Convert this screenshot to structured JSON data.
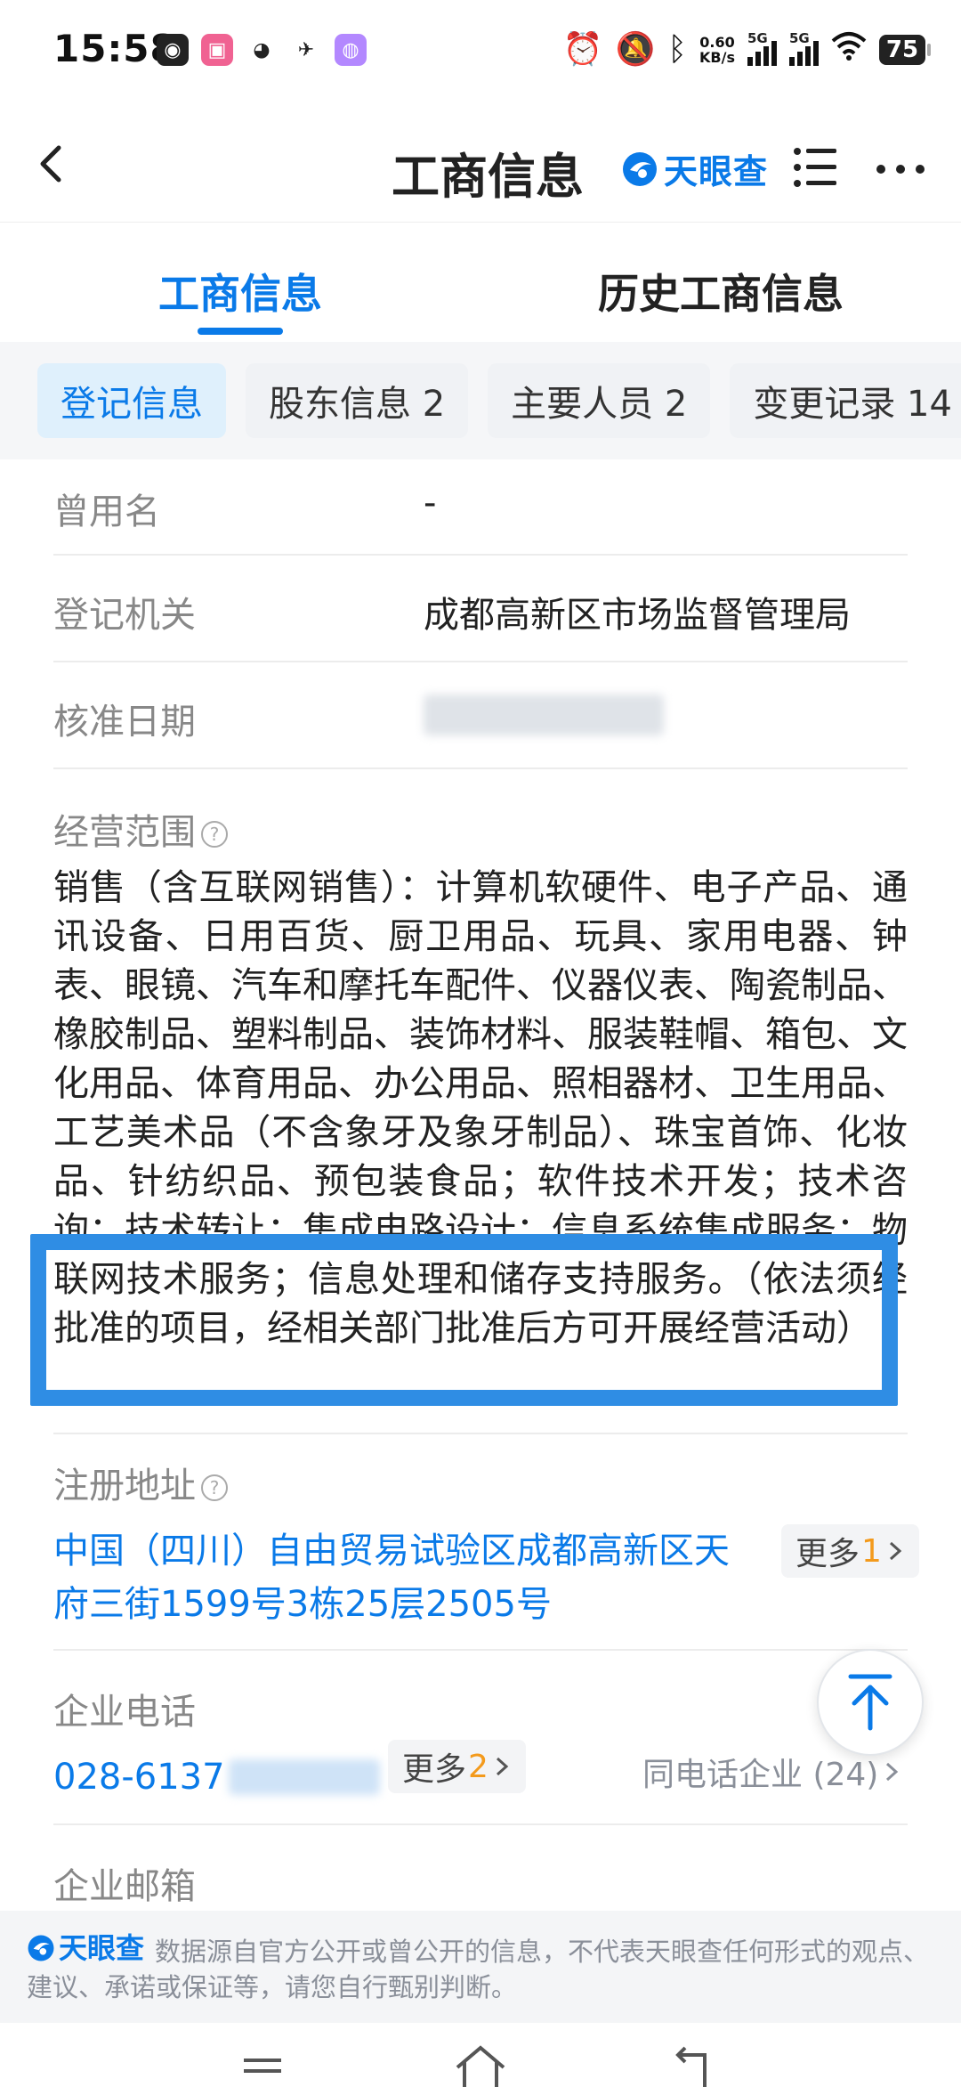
{
  "status_bar": {
    "time": "15:58",
    "network_speed_value": "0.60",
    "network_speed_unit": "KB/s",
    "signal_1_tag": "5G",
    "signal_2_tag": "5G",
    "battery": "75"
  },
  "header": {
    "title": "工商信息",
    "brand": "天眼查"
  },
  "main_tabs": [
    {
      "label": "工商信息",
      "active": true
    },
    {
      "label": "历史工商信息",
      "active": false
    }
  ],
  "sub_tabs": [
    {
      "label": "登记信息",
      "active": true
    },
    {
      "label": "股东信息 2",
      "active": false
    },
    {
      "label": "主要人员 2",
      "active": false
    },
    {
      "label": "变更记录 14",
      "active": false
    }
  ],
  "fields": {
    "former_name": {
      "label": "曾用名",
      "value": "-"
    },
    "registration_authority": {
      "label": "登记机关",
      "value": "成都高新区市场监督管理局"
    },
    "approval_date": {
      "label": "核准日期"
    },
    "business_scope": {
      "label": "经营范围",
      "value": "销售（含互联网销售）：计算机软硬件、电子产品、通讯设备、日用百货、厨卫用品、玩具、家用电器、钟表、眼镜、汽车和摩托车配件、仪器仪表、陶瓷制品、橡胶制品、塑料制品、装饰材料、服装鞋帽、箱包、文化用品、体育用品、办公用品、照相器材、卫生用品、工艺美术品（不含象牙及象牙制品）、珠宝首饰、化妆品、针纺织品、预包装食品；软件技术开发；技术咨询；技术转让；集成电路设计；信息系统集成服务；物联网技术服务；信息处理和储存支持服务。（依法须经批准的项目，经相关部门批准后方可开展经营活动）"
    },
    "registered_address": {
      "label": "注册地址",
      "value": "中国（四川）自由贸易试验区成都高新区天府三街1599号3栋25层2505号",
      "more_label": "更多",
      "more_count": "1"
    },
    "phone": {
      "label": "企业电话",
      "value": "028-6137",
      "more_label": "更多",
      "more_count": "2",
      "same_phone_text": "同电话企业 (24)"
    },
    "email": {
      "label": "企业邮箱"
    }
  },
  "disclaimer": {
    "brand": "天眼查",
    "text": "数据源自官方公开或曾公开的信息，不代表天眼查任何形式的观点、建议、承诺或保证等，请您自行甄别判断。"
  },
  "colors": {
    "accent": "#0a7ae8",
    "highlight_border": "#2f8de4",
    "more_count": "#f39a1c"
  }
}
